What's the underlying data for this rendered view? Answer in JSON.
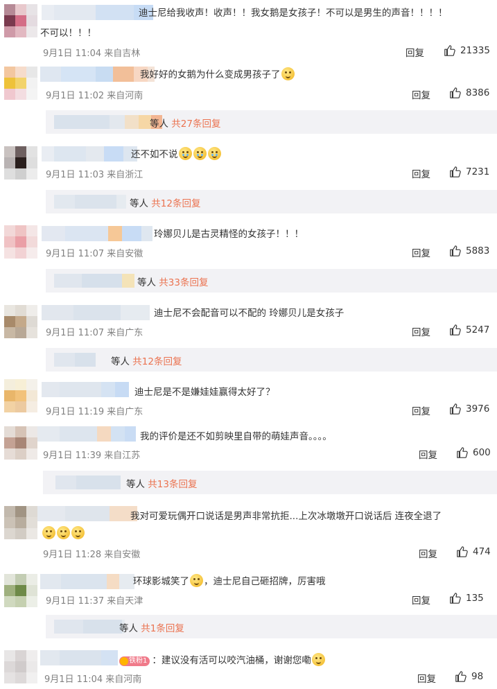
{
  "comments": [
    {
      "text_line1": "迪士尼给我收声！收声！！我女鹅是女孩子！不可以是男生的声音！！！！",
      "text_line2": "不可以！！！",
      "meta": "9月1日 11:04 来自吉林",
      "reply_label": "回复",
      "likes": "21335"
    },
    {
      "text": "我好好的女鹅为什么变成男孩子了",
      "meta": "9月1日 11:02 来自河南",
      "reply_label": "回复",
      "likes": "8386",
      "sub_suffix": "等人",
      "sub_link": "共27条回复"
    },
    {
      "text": "还不如不说",
      "meta": "9月1日 11:03 来自浙江",
      "reply_label": "回复",
      "likes": "7231",
      "sub_suffix": "等人",
      "sub_link": "共12条回复"
    },
    {
      "text": "玲娜贝儿是古灵精怪的女孩子！！！",
      "meta": "9月1日 11:07 来自安徽",
      "reply_label": "回复",
      "likes": "5883",
      "sub_suffix": "等人",
      "sub_link": "共33条回复"
    },
    {
      "text": "迪士尼不会配音可以不配的 玲娜贝儿是女孩子",
      "meta": "9月1日 11:07 来自广东",
      "reply_label": "回复",
      "likes": "5247",
      "sub_suffix": "等人",
      "sub_link": "共12条回复"
    },
    {
      "text": "迪士尼是不是嫌娃娃赢得太好了？",
      "meta": "9月1日 11:19 来自广东",
      "reply_label": "回复",
      "likes": "3976"
    },
    {
      "text": "我的评价是还不如剪映里自带的萌娃声音。。。。",
      "meta": "9月1日 11:39 来自江苏",
      "reply_label": "回复",
      "likes": "600",
      "sub_suffix": "等人",
      "sub_link": "共13条回复"
    },
    {
      "text": "我对可爱玩偶开口说话是男声非常抗拒...上次冰墩墩开口说话后 连夜全退了",
      "meta": "9月1日 11:28 来自安徽",
      "reply_label": "回复",
      "likes": "474"
    },
    {
      "text_before": "环球影城笑了",
      "text_after": "，迪士尼自己砸招牌，厉害哦",
      "meta": "9月1日 11:37 来自天津",
      "reply_label": "回复",
      "likes": "135",
      "sub_suffix": "等人",
      "sub_link": "共1条回复"
    },
    {
      "badge": "铁粉1",
      "text": "：建议没有活可以咬汽油桶，谢谢您嘞",
      "meta": "9月1日 11:04 来自河南",
      "reply_label": "回复",
      "likes": "98"
    }
  ],
  "colors": {
    "link": "#eb7350",
    "meta": "#808080",
    "subbox_bg": "#f2f2f5"
  },
  "icons": {
    "like": "thumbs-up-icon",
    "emoji": "smile-emoji-icon",
    "cry_emoji": "crying-emoji-icon",
    "question_emoji": "confused-emoji-icon"
  }
}
